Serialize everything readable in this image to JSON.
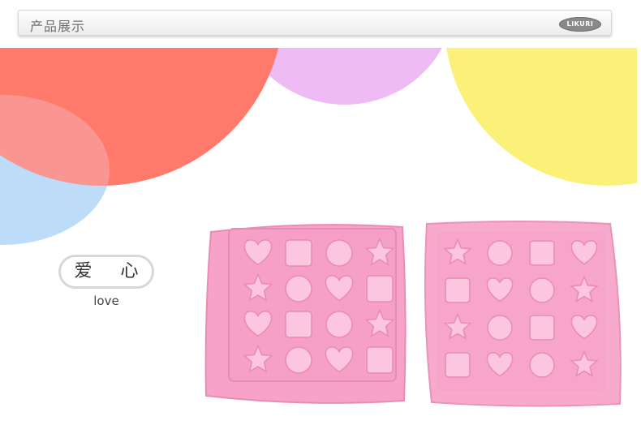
{
  "header": {
    "title": "产品展示",
    "brand": "LIKURI"
  },
  "product": {
    "name_cn": "爱 心",
    "name_en": "love",
    "colors": {
      "mold": "#f7a3c9",
      "mold_dark": "#e98bb5",
      "mold_light": "#fcc6df"
    },
    "left_tray_shapes": [
      "heart",
      "square",
      "flower",
      "star",
      "star",
      "flower",
      "heart",
      "square",
      "heart",
      "square",
      "flower",
      "star",
      "star",
      "flower",
      "heart",
      "square"
    ],
    "right_tray_shapes": [
      "star",
      "round",
      "square",
      "heart",
      "square",
      "heart",
      "round",
      "star",
      "star",
      "round",
      "square",
      "heart",
      "square",
      "heart",
      "round",
      "star"
    ]
  },
  "decor": {
    "circle_colors": [
      "#ff7a6a",
      "#efbbf4",
      "#fbf178",
      "#bcdcf9"
    ]
  }
}
